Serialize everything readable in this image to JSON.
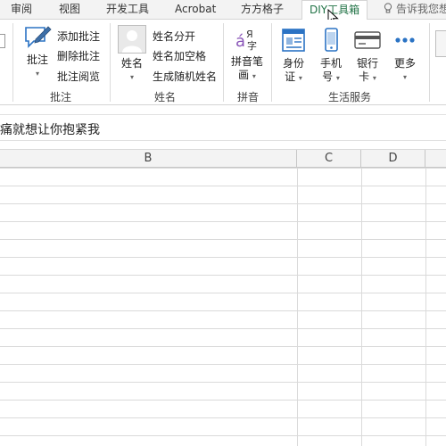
{
  "tabs": [
    {
      "label": "审阅"
    },
    {
      "label": "视图"
    },
    {
      "label": "开发工具"
    },
    {
      "label": "Acrobat"
    },
    {
      "label": "方方格子"
    },
    {
      "label": "DIY工具箱"
    }
  ],
  "tellme": "告诉我您想",
  "ribbon": {
    "groups": {
      "comments": {
        "label": "批注",
        "big_button": "批注",
        "small_buttons": [
          "添加批注",
          "删除批注",
          "批注阅览"
        ]
      },
      "names": {
        "label": "姓名",
        "big_button": "姓名",
        "small_buttons": [
          "姓名分开",
          "姓名加空格",
          "生成随机姓名"
        ]
      },
      "pinyin": {
        "label": "拼音",
        "big_button_line1": "拼音笔",
        "big_button_line2": "画"
      },
      "life": {
        "label": "生活服务",
        "buttons": [
          {
            "line1": "身份",
            "line2": "证"
          },
          {
            "line1": "手机",
            "line2": "号"
          },
          {
            "line1": "银行",
            "line2": "卡"
          },
          {
            "line1": "更多",
            "line2": ""
          }
        ]
      }
    }
  },
  "formula_bar": {
    "text": "痛就想让你抱紧我"
  },
  "columns": [
    "B",
    "C",
    "D"
  ],
  "colors": {
    "accent": "#217346",
    "icon_blue": "#2b73c4"
  }
}
